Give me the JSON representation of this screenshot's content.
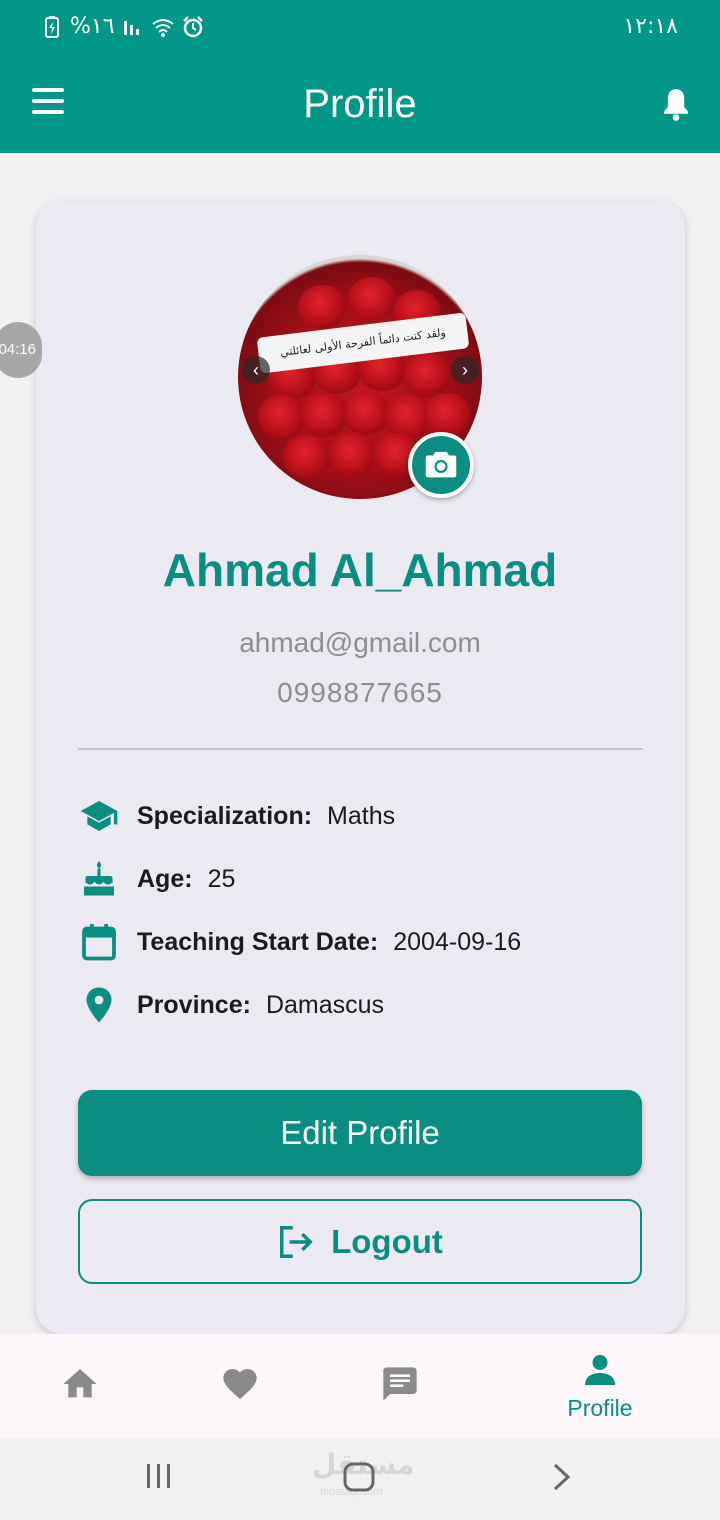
{
  "status_bar": {
    "battery": "%١٦",
    "time": "١٢:١٨"
  },
  "app_bar": {
    "title": "Profile",
    "menu_icon": "menu-icon",
    "notification_icon": "bell-icon"
  },
  "overlay": {
    "timer": "04:16"
  },
  "profile": {
    "photo_caption": "ولقد كنت دائماً الفرحة الأولى لعائلتي",
    "name": "Ahmad Al_Ahmad",
    "email": "ahmad@gmail.com",
    "phone": "0998877665",
    "info": [
      {
        "icon": "graduation-cap-icon",
        "label": "Specialization:",
        "value": "Maths"
      },
      {
        "icon": "cake-icon",
        "label": "Age:",
        "value": "25"
      },
      {
        "icon": "calendar-icon",
        "label": "Teaching Start Date:",
        "value": "2004-09-16"
      },
      {
        "icon": "location-pin-icon",
        "label": "Province:",
        "value": "Damascus"
      }
    ],
    "edit_button": "Edit Profile",
    "logout_button": "Logout"
  },
  "bottom_nav": {
    "items": [
      {
        "icon": "home-icon",
        "label": ""
      },
      {
        "icon": "heart-icon",
        "label": ""
      },
      {
        "icon": "chat-icon",
        "label": ""
      },
      {
        "icon": "person-icon",
        "label": "Profile",
        "active": true
      }
    ]
  },
  "system_nav": {
    "watermark": "مستقل",
    "watermark_sub": "mostaql.com"
  },
  "colors": {
    "primary": "#009688",
    "primary_dark": "#0a8d83",
    "card_bg": "#ebe9f2",
    "inactive_icon": "#8a8a8a"
  }
}
